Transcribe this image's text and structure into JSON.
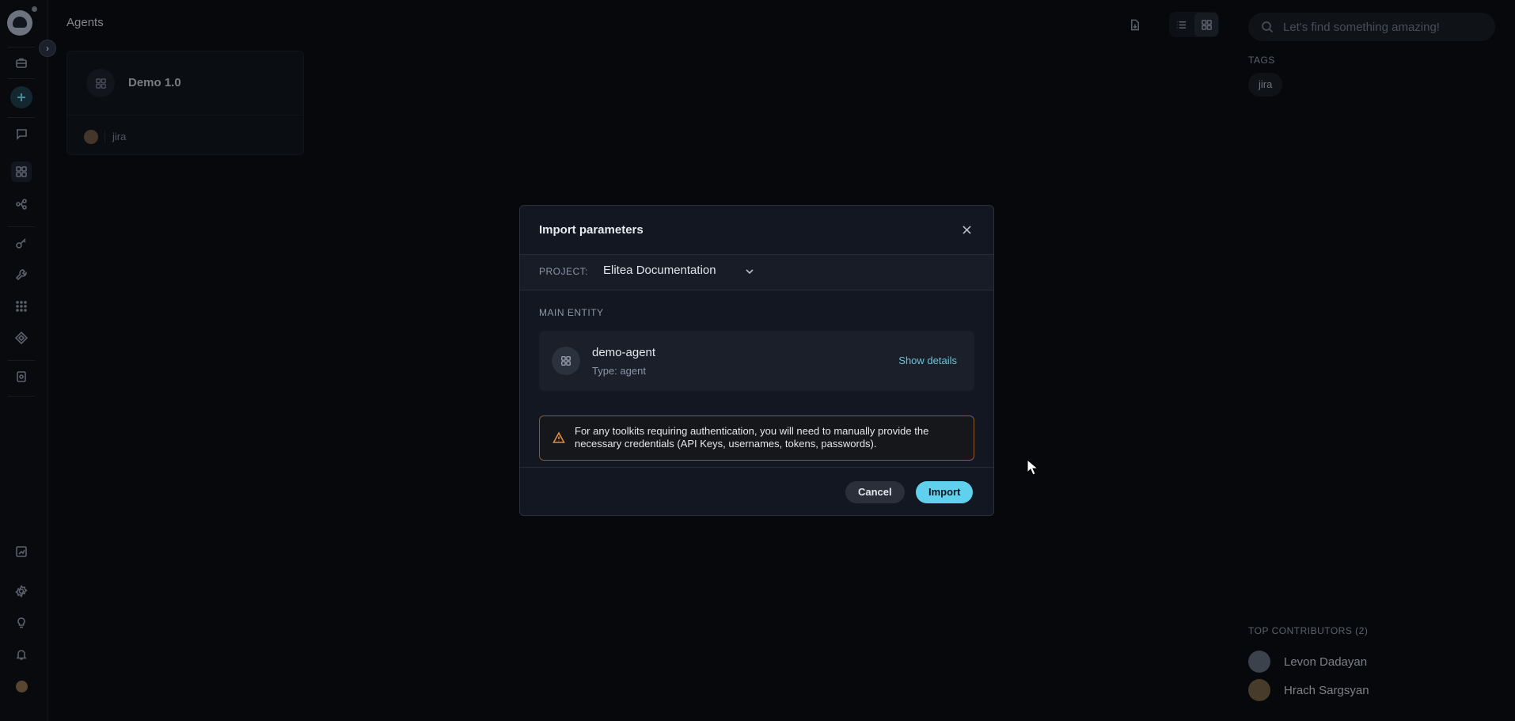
{
  "header": {
    "title": "Agents",
    "search_placeholder": "Let's find something amazing!"
  },
  "card": {
    "title": "Demo 1.0",
    "tag": "jira"
  },
  "tags_panel": {
    "title": "TAGS",
    "tags": [
      "jira"
    ]
  },
  "contributors": {
    "title": "TOP CONTRIBUTORS (2)",
    "items": [
      {
        "name": "Levon Dadayan",
        "avatar_color": "#5d6675"
      },
      {
        "name": "Hrach Sargsyan",
        "avatar_color": "#6e5b44"
      }
    ]
  },
  "modal": {
    "title": "Import parameters",
    "project_label": "PROJECT:",
    "project_value": "Elitea Documentation",
    "main_entity_label": "MAIN ENTITY",
    "entity": {
      "name": "demo-agent",
      "type": "Type: agent",
      "show_details": "Show details"
    },
    "warning": "For any toolkits requiring authentication, you will need to manually provide the necessary credentials (API Keys, usernames, tokens, passwords).",
    "cancel_label": "Cancel",
    "import_label": "Import"
  },
  "colors": {
    "accent": "#5fd1ec",
    "warning": "#e08a3c",
    "background": "#0b0d12"
  }
}
